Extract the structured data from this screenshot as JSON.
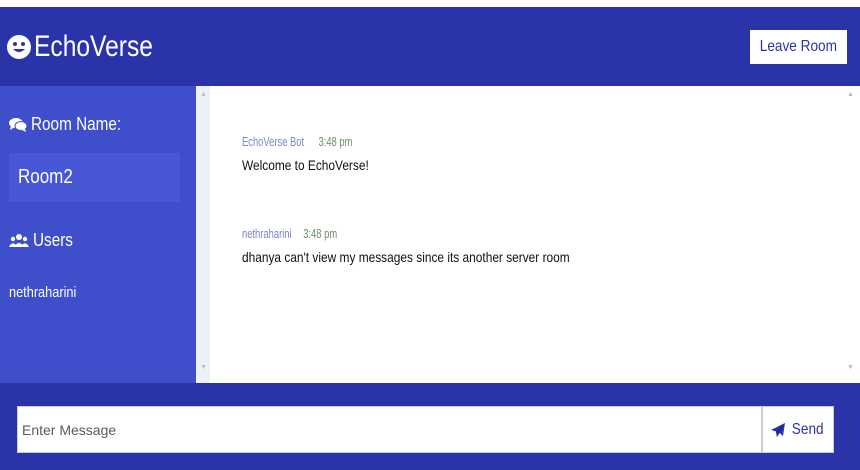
{
  "header": {
    "brand_icon": "smiley-icon",
    "title": "EchoVerse",
    "leave_button": "Leave Room"
  },
  "sidebar": {
    "room_heading_icon": "comments-icon",
    "room_heading": "Room Name:",
    "room_name": "Room2",
    "users_heading_icon": "users-icon",
    "users_heading": "Users",
    "users": [
      "nethraharini"
    ]
  },
  "messages": [
    {
      "author": "EchoVerse Bot",
      "time": "3:48 pm",
      "text": "Welcome to EchoVerse!"
    },
    {
      "author": "nethraharini",
      "time": "3:48 pm",
      "text": "dhanya can't view my messages since its another server room"
    }
  ],
  "composer": {
    "placeholder": "Enter Message",
    "value": "",
    "send_icon": "paper-plane-icon",
    "send_label": "Send"
  },
  "colors": {
    "primary": "#2a34a8",
    "sidebar": "#3f4fcc",
    "room_box": "#4757d6",
    "author": "#7a86cf",
    "time": "#6e8f6e"
  }
}
